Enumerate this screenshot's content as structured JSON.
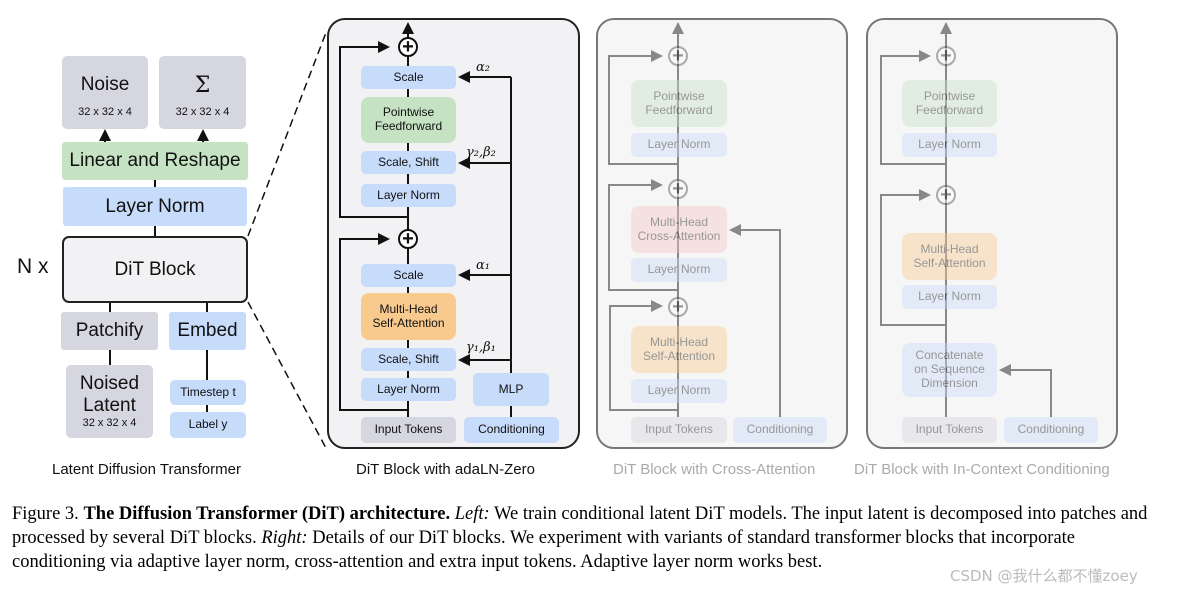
{
  "left": {
    "noise": "Noise",
    "noise_dim": "32 x 32 x 4",
    "sigma": "Σ",
    "sigma_dim": "32 x 32 x 4",
    "linear": "Linear and Reshape",
    "layer_norm": "Layer Norm",
    "dit_block": "DiT Block",
    "n_x": "N x",
    "patchify": "Patchify",
    "embed": "Embed",
    "noised_latent_1": "Noised",
    "noised_latent_2": "Latent",
    "noised_latent_dim": "32 x 32 x 4",
    "timestep": "Timestep t",
    "label": "Label y",
    "title": "Latent Diffusion Transformer"
  },
  "adaln": {
    "scale": "Scale",
    "pointwise_1": "Pointwise",
    "pointwise_2": "Feedforward",
    "scale_shift": "Scale, Shift",
    "layer_norm": "Layer Norm",
    "mhsa_1": "Multi-Head",
    "mhsa_2": "Self-Attention",
    "input_tokens": "Input Tokens",
    "mlp": "MLP",
    "conditioning": "Conditioning",
    "alpha2": "α₂",
    "gb2": "γ₂,β₂",
    "alpha1": "α₁",
    "gb1": "γ₁,β₁",
    "title": "DiT Block with adaLN-Zero"
  },
  "cross": {
    "pointwise_1": "Pointwise",
    "pointwise_2": "Feedforward",
    "layer_norm": "Layer Norm",
    "mhca_1": "Multi-Head",
    "mhca_2": "Cross-Attention",
    "mhsa_1": "Multi-Head",
    "mhsa_2": "Self-Attention",
    "input_tokens": "Input Tokens",
    "conditioning": "Conditioning",
    "title": "DiT Block with Cross-Attention"
  },
  "incontext": {
    "pointwise_1": "Pointwise",
    "pointwise_2": "Feedforward",
    "layer_norm": "Layer Norm",
    "mhsa_1": "Multi-Head",
    "mhsa_2": "Self-Attention",
    "concat_1": "Concatenate",
    "concat_2": "on Sequence",
    "concat_3": "Dimension",
    "input_tokens": "Input Tokens",
    "conditioning": "Conditioning",
    "title": "DiT Block with In-Context Conditioning"
  },
  "caption": {
    "fig": "Figure 3.",
    "bold": "The Diffusion Transformer (DiT) architecture.",
    "left_label": "Left:",
    "left_text": "We train conditional latent DiT models. The input latent is decomposed into patches and processed by several DiT blocks.",
    "right_label": "Right:",
    "right_text": "Details of our DiT blocks. We experiment with variants of standard transformer blocks that incorporate conditioning via adaptive layer norm, cross-attention and extra input tokens. Adaptive layer norm works best."
  },
  "watermark": "CSDN @我什么都不懂zoey"
}
